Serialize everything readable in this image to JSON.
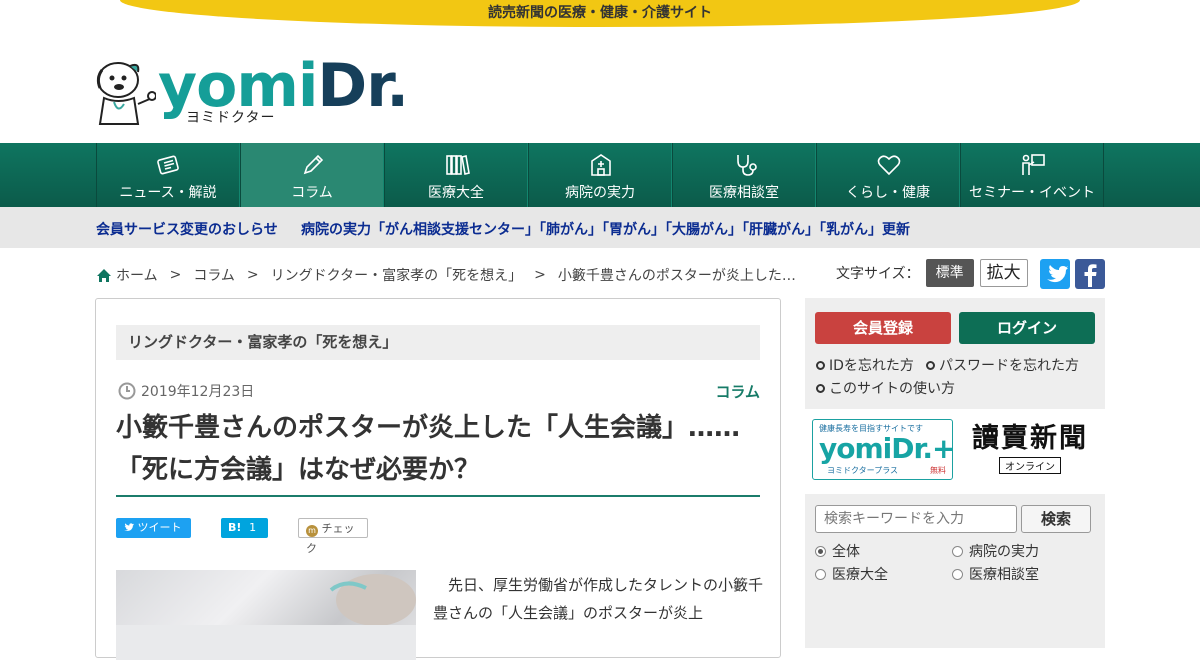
{
  "topbar": {
    "text": "読売新聞の医療・健康・介護サイト"
  },
  "logo": {
    "word_main": "yomi",
    "word_dr": "Dr.",
    "kana": "ヨミドクター"
  },
  "nav": {
    "items": [
      {
        "label": "ニュース・解説",
        "icon": "newspaper-icon"
      },
      {
        "label": "コラム",
        "icon": "pencil-icon",
        "active": true
      },
      {
        "label": "医療大全",
        "icon": "books-icon"
      },
      {
        "label": "病院の実力",
        "icon": "hospital-icon"
      },
      {
        "label": "医療相談室",
        "icon": "stethoscope-icon"
      },
      {
        "label": "くらし・健康",
        "icon": "heart-icon"
      },
      {
        "label": "セミナー・イベント",
        "icon": "presenter-icon"
      }
    ]
  },
  "notice": {
    "link1": "会員サービス変更のおしらせ",
    "link2": "病院の実力「がん相談支援センター」「肺がん」「胃がん」「大腸がん」「肝臓がん」「乳がん」更新"
  },
  "breadcrumb": {
    "home": "ホーム",
    "sep": ">",
    "column": "コラム",
    "series": "リングドクター・富家孝の「死を想え」",
    "current": "小籔千豊さんのポスターが炎上した…"
  },
  "fontsize": {
    "label": "文字サイズ：",
    "standard": "標準",
    "large": "拡大"
  },
  "article": {
    "series_heading": "リングドクター・富家孝の「死を想え」",
    "date": "2019年12月23日",
    "category": "コラム",
    "title": "小籔千豊さんのポスターが炎上した「人生会議」……「死に方会議」はなぜ必要か？",
    "share": {
      "tweet": "ツイート",
      "hatena": "B!",
      "hatena_count": "1",
      "check": "チェック"
    },
    "body": "先日、厚生労働省が作成したタレントの小籔千豊さんの「人生会議」のポスターが炎上"
  },
  "sidebar": {
    "register": "会員登録",
    "login": "ログイン",
    "forgot_id": "IDを忘れた方",
    "forgot_pw": "パスワードを忘れた方",
    "howto": "このサイトの使い方",
    "banner_plus": {
      "tag": "健康長寿を目指すサイトです",
      "word": "yomiDr.+",
      "kana": "ヨミドクタープラス",
      "free": "無料"
    },
    "banner_yomiuri": {
      "title": "讀賣新聞",
      "sub": "オンライン"
    },
    "search": {
      "placeholder": "検索キーワードを入力",
      "button": "検索",
      "options": [
        {
          "label": "全体",
          "checked": true
        },
        {
          "label": "病院の実力",
          "checked": false
        },
        {
          "label": "医療大全",
          "checked": false
        },
        {
          "label": "医療相談室",
          "checked": false
        }
      ]
    }
  },
  "colors": {
    "teal": "#0f7560",
    "register": "#c9423f",
    "login": "#0d6e55",
    "twitter": "#1da1f2",
    "facebook": "#3b5998",
    "gold": "#f2c713"
  }
}
